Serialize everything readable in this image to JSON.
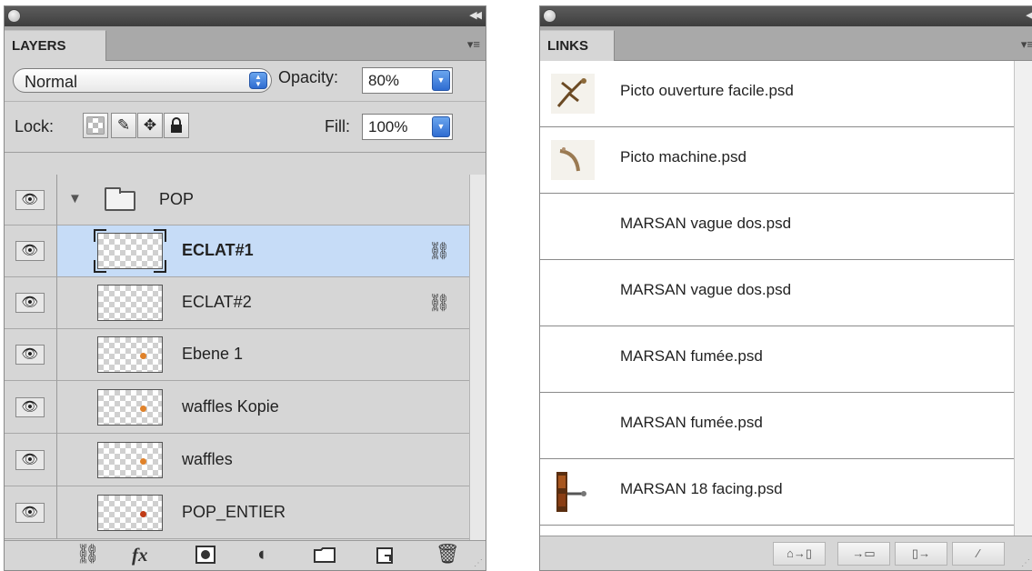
{
  "layers_panel": {
    "tab_label": "LAYERS",
    "blend_mode": "Normal",
    "opacity_label": "Opacity:",
    "opacity_value": "80%",
    "lock_label": "Lock:",
    "fill_label": "Fill:",
    "fill_value": "100%",
    "group": {
      "name": "POP",
      "expanded": true
    },
    "layers": [
      {
        "name": "ECLAT#1",
        "selected": true,
        "linked": true,
        "icon": "transparent-thumbnail"
      },
      {
        "name": "ECLAT#2",
        "selected": false,
        "linked": true,
        "icon": "transparent-thumbnail"
      },
      {
        "name": "Ebene 1",
        "selected": false,
        "linked": false,
        "icon": "thumbnail-orange-dot"
      },
      {
        "name": "waffles Kopie",
        "selected": false,
        "linked": false,
        "icon": "thumbnail-orange-dot"
      },
      {
        "name": "waffles",
        "selected": false,
        "linked": false,
        "icon": "thumbnail-orange-dot"
      },
      {
        "name": "POP_ENTIER",
        "selected": false,
        "linked": false,
        "icon": "thumbnail-red-dot"
      }
    ],
    "bottom_icons": [
      "link-layers-icon",
      "fx-icon",
      "mask-icon",
      "adjustment-icon",
      "new-group-icon",
      "new-layer-icon",
      "trash-icon"
    ],
    "fx_text": "fx"
  },
  "links_panel": {
    "tab_label": "LINKS",
    "items": [
      {
        "name": "Picto ouverture facile.psd"
      },
      {
        "name": "Picto machine.psd"
      },
      {
        "name": "MARSAN vague dos.psd"
      },
      {
        "name": "MARSAN vague dos.psd"
      },
      {
        "name": "MARSAN fumée.psd"
      },
      {
        "name": "MARSAN fumée.psd"
      },
      {
        "name": "MARSAN 18 facing.psd"
      }
    ],
    "bottom_icons": [
      "relink-icon",
      "go-to-link-icon",
      "update-link-icon",
      "edit-original-icon"
    ]
  },
  "colors": {
    "panel_bg": "#d6d6d6",
    "selection": "#c6dcf7",
    "accent_blue": "#2f6cd1",
    "titlebar": "#4a4a4a"
  }
}
